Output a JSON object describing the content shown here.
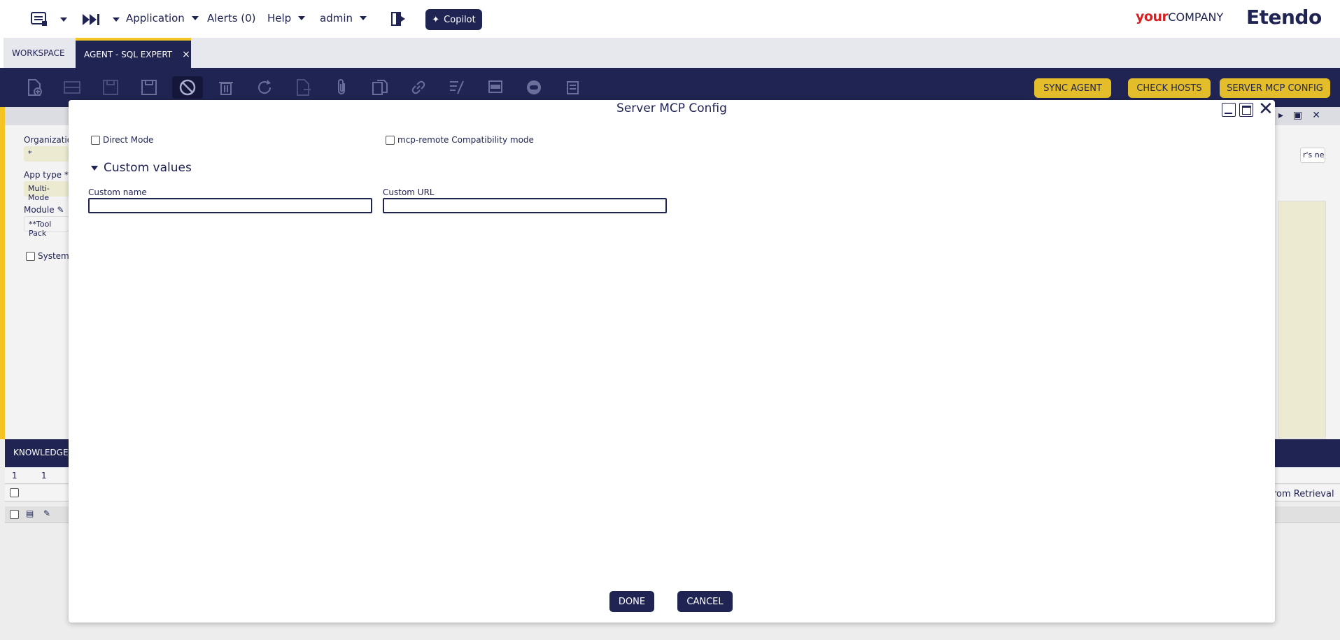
{
  "topnav": {
    "application_label": "Application",
    "alerts_label": "Alerts (0)",
    "help_label": "Help",
    "user_label": "admin",
    "copilot_label": "Copilot",
    "brand_your": "your",
    "brand_company": "COMPANY",
    "brand_etendo": "Etendo"
  },
  "tabs": {
    "workspace_label": "WORKSPACE",
    "agent_label": "AGENT - SQL EXPERT",
    "close_glyph": "×"
  },
  "toolbar": {
    "sync_agent_label": "SYNC AGENT",
    "check_hosts_label": "CHECK HOSTS",
    "server_mcp_config_label": "SERVER MCP CONFIG"
  },
  "background": {
    "organization_label": "Organizatio",
    "organization_value": "*",
    "app_type_label": "App type *",
    "app_type_value": "Multi-Mode",
    "module_label": "Module",
    "module_value": "**Tool Pack",
    "system_label": "System",
    "needs_text": "r's needs, c",
    "knowledge_label": "KNOWLEDGE -",
    "grid_col1": "1",
    "grid_col2": "1",
    "retrieval_text": "rom Retrieval"
  },
  "modal": {
    "title": "Server MCP Config",
    "direct_mode_label": "Direct Mode",
    "mcp_remote_label": "mcp-remote Compatibility mode",
    "section_title": "Custom values",
    "custom_name_label": "Custom name",
    "custom_name_value": "",
    "custom_url_label": "Custom URL",
    "custom_url_value": "",
    "done_label": "DONE",
    "cancel_label": "CANCEL"
  },
  "colors": {
    "brand_navy": "#202452",
    "accent_yellow": "#f4c425",
    "action_button": "#e3bd2a",
    "brand_red": "#d42222"
  }
}
